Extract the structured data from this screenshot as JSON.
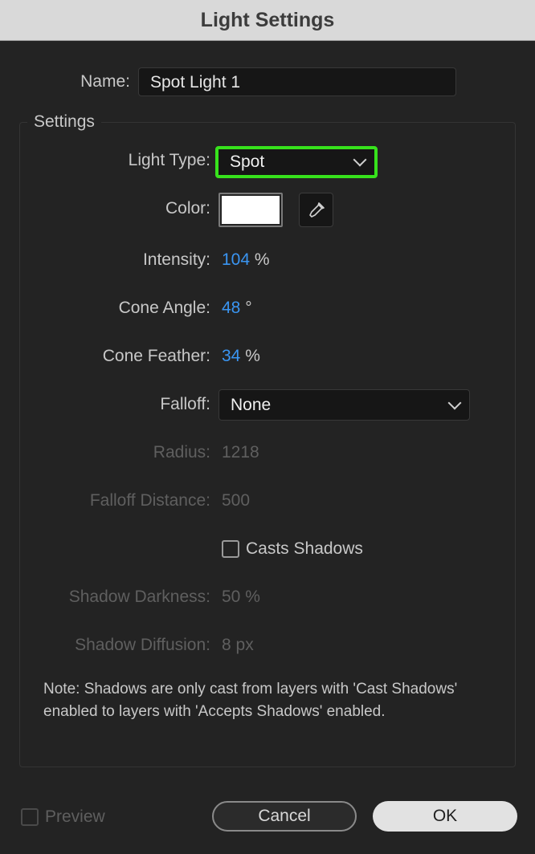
{
  "title": "Light Settings",
  "name": {
    "label": "Name:",
    "value": "Spot Light 1"
  },
  "settings": {
    "group_title": "Settings",
    "light_type": {
      "label": "Light Type:",
      "value": "Spot"
    },
    "color": {
      "label": "Color:",
      "swatch": "#ffffff"
    },
    "intensity": {
      "label": "Intensity:",
      "value": "104",
      "unit": "%"
    },
    "cone_angle": {
      "label": "Cone Angle:",
      "value": "48",
      "unit": "°"
    },
    "cone_feather": {
      "label": "Cone Feather:",
      "value": "34",
      "unit": "%"
    },
    "falloff": {
      "label": "Falloff:",
      "value": "None"
    },
    "radius": {
      "label": "Radius:",
      "value": "1218"
    },
    "falloff_distance": {
      "label": "Falloff Distance:",
      "value": "500"
    },
    "casts_shadows": {
      "label": "Casts Shadows",
      "checked": false
    },
    "shadow_darkness": {
      "label": "Shadow Darkness:",
      "value": "50 %"
    },
    "shadow_diffusion": {
      "label": "Shadow Diffusion:",
      "value": "8 px"
    },
    "note": "Note: Shadows are only cast from layers with 'Cast Shadows' enabled to layers with 'Accepts Shadows' enabled."
  },
  "footer": {
    "preview_label": "Preview",
    "preview_checked": false,
    "cancel_label": "Cancel",
    "ok_label": "OK"
  },
  "colors": {
    "accent_value": "#3a95f2",
    "highlight_border": "#37e21c"
  },
  "icons": {
    "eyedropper": "eyedropper-icon",
    "dropdown": "chevron-down-icon"
  }
}
